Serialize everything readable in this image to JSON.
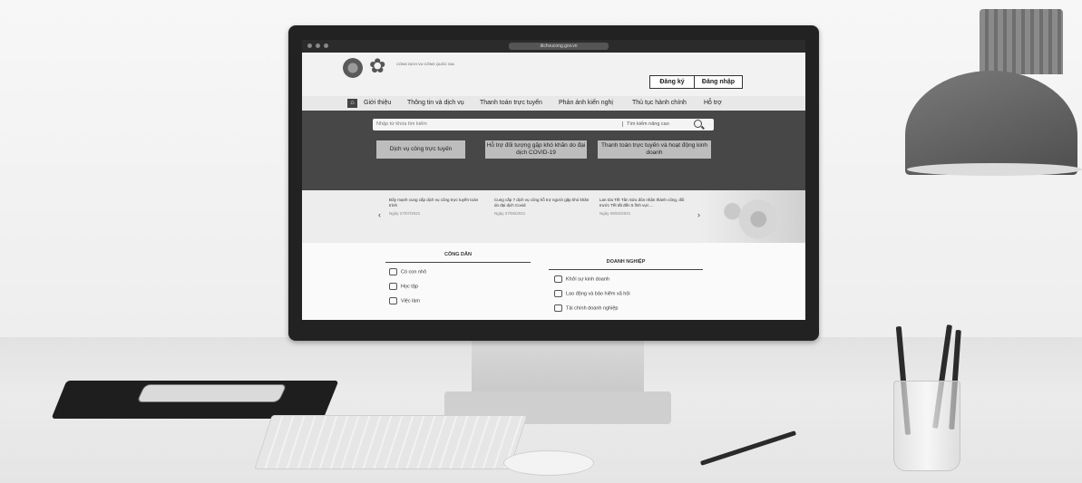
{
  "browser": {
    "url": "dichvucong.gov.vn"
  },
  "site": {
    "org_name": "CỔNG DỊCH VỤ CÔNG QUỐC GIA",
    "buttons": {
      "register": "Đăng ký",
      "login": "Đăng nhập"
    },
    "nav": [
      "Giới thiệu",
      "Thông tin và dịch vụ",
      "Thanh toán trực tuyến",
      "Phản ánh kiến nghị",
      "Thủ tục hành chính",
      "Hỗ trợ"
    ],
    "search": {
      "placeholder": "Nhập từ khóa tìm kiếm",
      "advanced": "Tìm kiếm nâng cao"
    },
    "services": [
      "Dịch vụ công trực tuyến",
      "Hỗ trợ đối tượng gặp khó khăn do đại dịch COVID-19",
      "Thanh toán trực tuyến và hoạt động kinh doanh"
    ],
    "news": [
      {
        "title": "Đẩy mạnh cung cấp dịch vụ công trực tuyến toàn trình",
        "date": "Ngày 27/07/2021"
      },
      {
        "title": "Cung cấp 7 dịch vụ công hỗ trợ người gặp khó khăn do đại dịch Covid",
        "date": "Ngày 27/06/2021"
      },
      {
        "title": "Lan tỏa Tết Tân Sửu đón nhận thành công, đổi trước Tết tất đến 5 lĩnh vực ...",
        "date": "Ngày 09/02/2021"
      }
    ],
    "citizen": {
      "heading": "CÔNG DÂN",
      "items": [
        "Có con nhỏ",
        "Học tập",
        "Việc làm"
      ]
    },
    "business": {
      "heading": "DOANH NGHIỆP",
      "items": [
        "Khởi sự kinh doanh",
        "Lao động và bảo hiểm xã hội",
        "Tài chính doanh nghiệp"
      ]
    }
  }
}
